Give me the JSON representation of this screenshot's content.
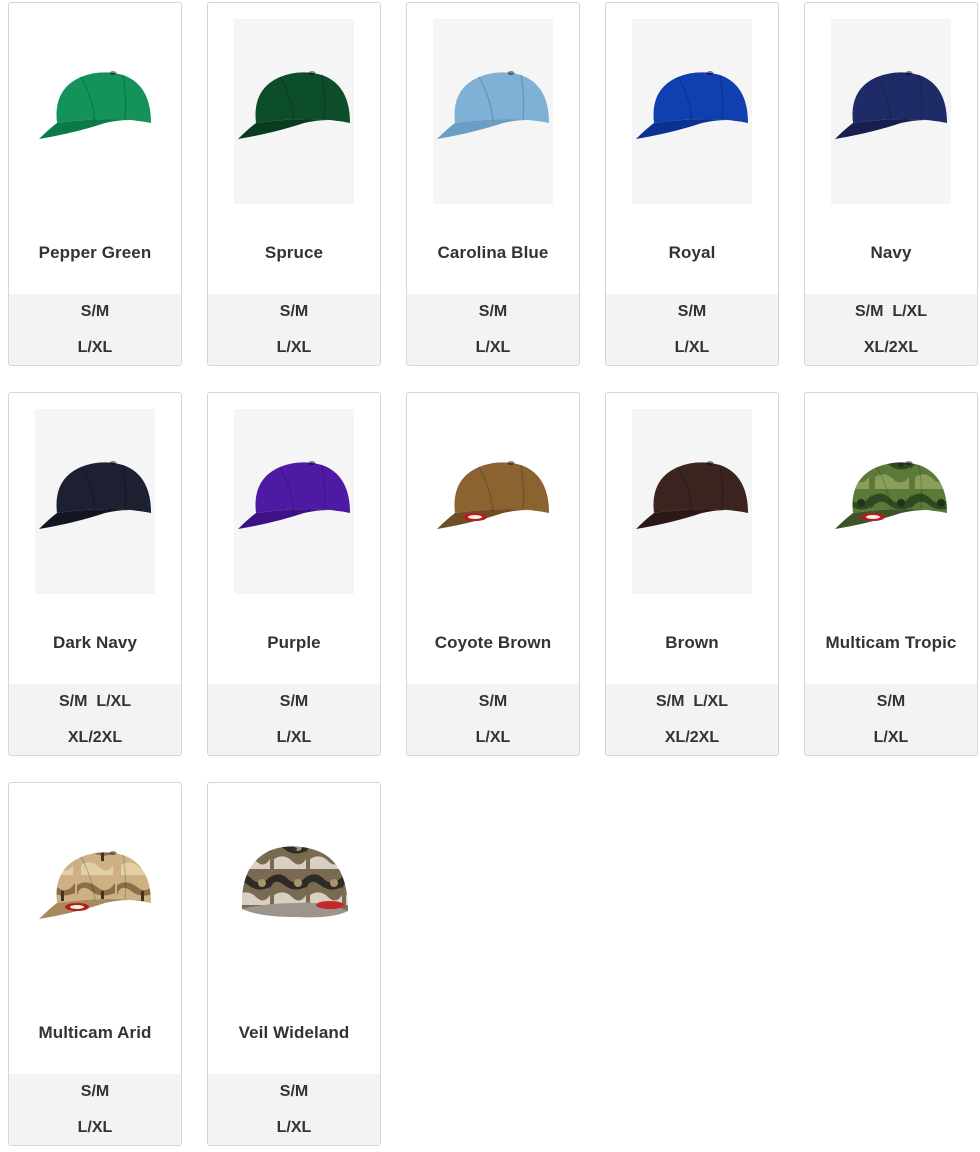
{
  "products": [
    {
      "name": "Pepper Green",
      "sizes": [
        "S/M",
        "L/XL"
      ],
      "color": "#13925a",
      "visor": "#0c7a48",
      "pattern": "solid",
      "bg": false
    },
    {
      "name": "Spruce",
      "sizes": [
        "S/M",
        "L/XL"
      ],
      "color": "#0c4d2a",
      "visor": "#083b20",
      "pattern": "solid",
      "bg": true
    },
    {
      "name": "Carolina Blue",
      "sizes": [
        "S/M",
        "L/XL"
      ],
      "color": "#7fb1d6",
      "visor": "#6a9ec4",
      "pattern": "solid",
      "bg": true
    },
    {
      "name": "Royal",
      "sizes": [
        "S/M",
        "L/XL"
      ],
      "color": "#0f3fb0",
      "visor": "#0a3290",
      "pattern": "solid",
      "bg": true
    },
    {
      "name": "Navy",
      "sizes": [
        "S/M  L/XL",
        "XL/2XL"
      ],
      "color": "#1f2b66",
      "visor": "#161f4f",
      "pattern": "solid",
      "bg": true
    },
    {
      "name": "Dark Navy",
      "sizes": [
        "S/M  L/XL",
        "XL/2XL"
      ],
      "color": "#1c2030",
      "visor": "#121522",
      "pattern": "solid",
      "bg": true
    },
    {
      "name": "Purple",
      "sizes": [
        "S/M",
        "L/XL"
      ],
      "color": "#4e1aa3",
      "visor": "#3d1285",
      "pattern": "solid",
      "bg": true
    },
    {
      "name": "Coyote Brown",
      "sizes": [
        "S/M",
        "L/XL"
      ],
      "color": "#8a6331",
      "visor": "#6f4e25",
      "pattern": "solid",
      "bg": false
    },
    {
      "name": "Brown",
      "sizes": [
        "S/M  L/XL",
        "XL/2XL"
      ],
      "color": "#3b2320",
      "visor": "#2c1816",
      "pattern": "solid",
      "bg": true
    },
    {
      "name": "Multicam Tropic",
      "sizes": [
        "S/M",
        "L/XL"
      ],
      "color": "#556b35",
      "visor": "#3f5228",
      "pattern": "camo-green",
      "bg": false
    },
    {
      "name": "Multicam Arid",
      "sizes": [
        "S/M",
        "L/XL"
      ],
      "color": "#c4a474",
      "visor": "#a88a5c",
      "pattern": "camo-tan",
      "bg": false
    },
    {
      "name": "Veil Wideland",
      "sizes": [
        "S/M",
        "L/XL"
      ],
      "color": "#6b5a45",
      "visor": "#4a3d30",
      "pattern": "camo-veil",
      "bg": false
    }
  ]
}
